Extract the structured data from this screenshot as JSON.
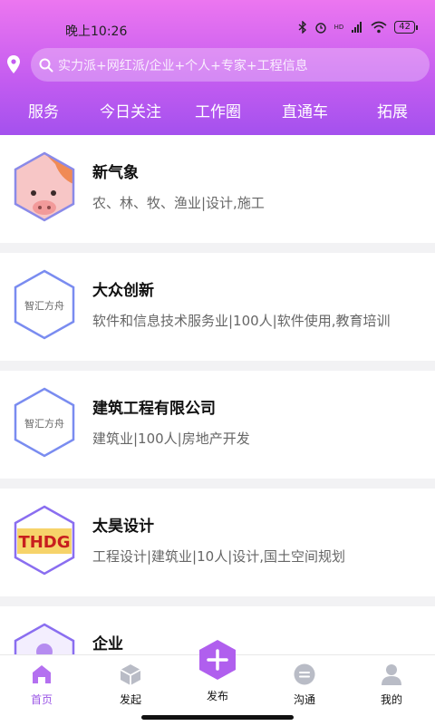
{
  "status_bar": {
    "time": "晚上10:26",
    "battery": "42",
    "network": "HD"
  },
  "search": {
    "placeholder": "实力派+网红派/企业+个人+专家+工程信息"
  },
  "tabs": [
    "服务",
    "今日关注",
    "工作圈",
    "直通车",
    "拓展"
  ],
  "cards": [
    {
      "title": "新气象",
      "desc": "农、林、牧、渔业|设计,施工",
      "logo": "pig"
    },
    {
      "title": "大众创新",
      "desc": "软件和信息技术服务业|100人|软件使用,教育培训",
      "logo": "智汇方舟"
    },
    {
      "title": "建筑工程有限公司",
      "desc": "建筑业|100人|房地产开发",
      "logo": "智汇方舟"
    },
    {
      "title": "太昊设计",
      "desc": "工程设计|建筑业|10人|设计,国土空间规划",
      "logo": "THDG"
    },
    {
      "title": "企业",
      "desc": "",
      "logo": "person"
    }
  ],
  "nav": {
    "home": "首页",
    "initiate": "发起",
    "publish": "发布",
    "chat": "沟通",
    "mine": "我的"
  },
  "colors": {
    "accent": "#9b57e6",
    "header_top": "#ec76f0",
    "header_bottom": "#a451ee"
  }
}
